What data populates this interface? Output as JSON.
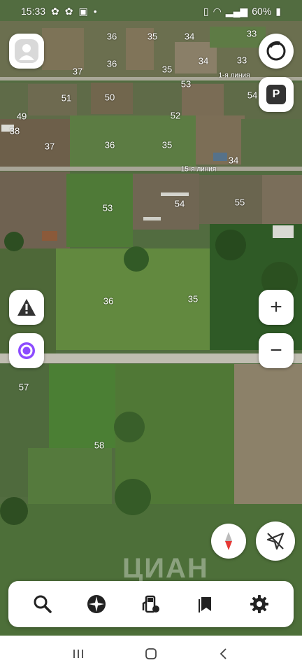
{
  "status_bar": {
    "time": "15:33",
    "battery": "60%"
  },
  "map": {
    "plot_labels": [
      "36",
      "35",
      "34",
      "33",
      "37",
      "36",
      "35",
      "34",
      "33",
      "53",
      "51",
      "50",
      "54",
      "49",
      "38",
      "52",
      "37",
      "36",
      "35",
      "34",
      "53",
      "54",
      "55",
      "36",
      "35",
      "57",
      "58"
    ],
    "street_labels": [
      "1-я линия",
      "15-я линия"
    ],
    "watermark": "ЦИАН"
  },
  "buttons": {
    "profile": "profile-icon",
    "layers": "layers-icon",
    "parking": "P",
    "alert": "!",
    "alice": "alice-icon",
    "zoom_in": "+",
    "zoom_out": "−",
    "compass": "compass-icon",
    "location": "location-icon"
  },
  "toolbar": {
    "items": [
      "search-icon",
      "discovery-icon",
      "gas-station-icon",
      "bookmarks-icon",
      "settings-icon"
    ]
  },
  "navbar": {
    "items": [
      "recent-apps-icon",
      "home-icon",
      "back-icon"
    ]
  }
}
